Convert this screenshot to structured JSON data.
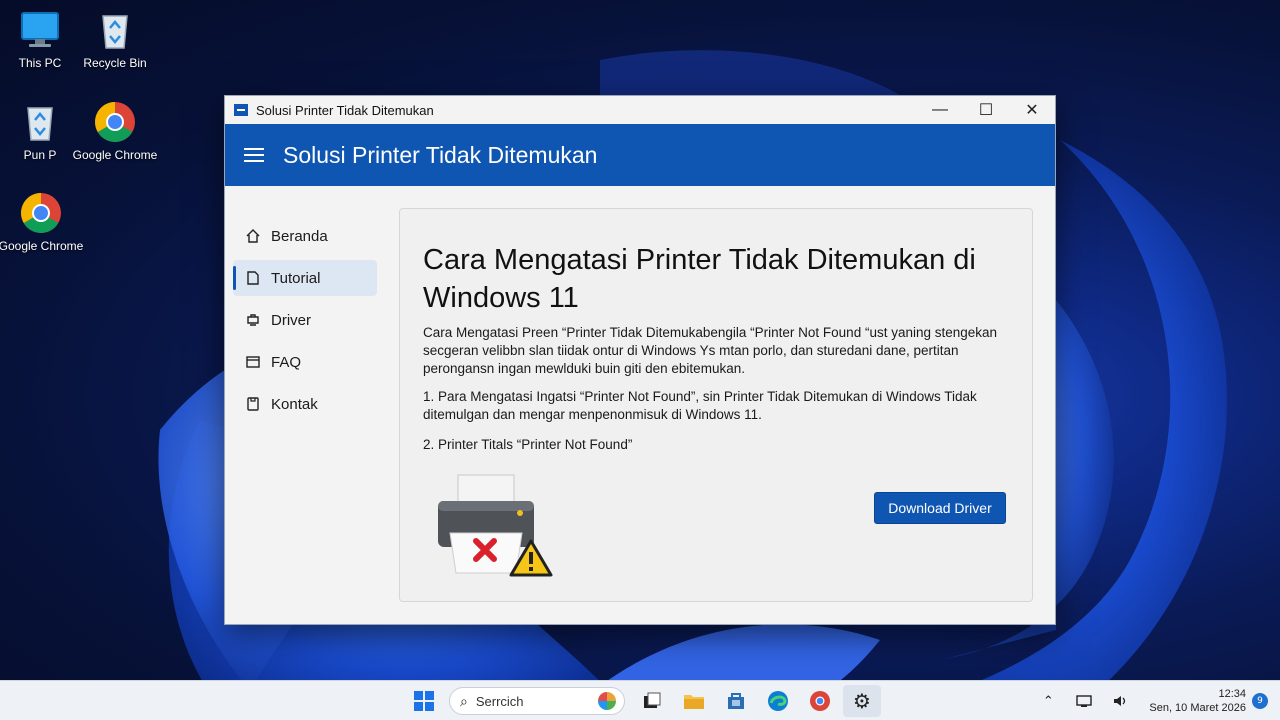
{
  "desktop": {
    "icons": [
      {
        "label": "This PC",
        "icon": "monitor-icon"
      },
      {
        "label": "Recycle Bin",
        "icon": "recycle-bin-icon"
      },
      {
        "label": "Pun P",
        "icon": "recycle-bin-icon"
      },
      {
        "label": "Google Chrome",
        "icon": "chrome-icon"
      },
      {
        "label": "Google Chrome",
        "icon": "chrome-icon"
      }
    ]
  },
  "window": {
    "title": "Solusi Printer Tidak Ditemukan",
    "controls": {
      "minimize": "—",
      "maximize": "☐",
      "close": "✕"
    },
    "app_title": "Solusi Printer Tidak Ditemukan"
  },
  "sidebar": {
    "items": [
      {
        "label": "Beranda",
        "icon": "home-icon",
        "active": false
      },
      {
        "label": "Tutorial",
        "icon": "document-icon",
        "active": true
      },
      {
        "label": "Driver",
        "icon": "driver-icon",
        "active": false
      },
      {
        "label": "FAQ",
        "icon": "faq-icon",
        "active": false
      },
      {
        "label": "Kontak",
        "icon": "contact-icon",
        "active": false
      }
    ]
  },
  "content": {
    "heading": "Cara Mengatasi Printer Tidak Ditemukan di Windows 11",
    "intro": "Cara Mengatasi Preen “Printer Tidak Ditemukabengila “Printer Not Found “ust yaning stengekan secgeran velibbn slan tiidak ontur di Windows Ys mtan porlo, dan sturedani dane, pertitan perongansn ingan mewlduki buin giti den ebitemukan.",
    "step1": "1. Para Mengatasi Ingatsi “Printer Not Found”, sin Printer Tidak Ditemukan di Windows Tidak ditemulgan dan mengar menpenonmisuk di Windows 11.",
    "step2": "2. Printer Titals “Printer Not Found”",
    "download_button": "Download Driver"
  },
  "taskbar": {
    "search_placeholder": "Serrcich",
    "time": "12:34",
    "date": "Sen, 10 Maret 2026",
    "notification_count": "9"
  },
  "colors": {
    "accent": "#0f56b3",
    "window_bg": "#f3f3f3",
    "warning": "#f5c518",
    "error": "#d9202b"
  }
}
